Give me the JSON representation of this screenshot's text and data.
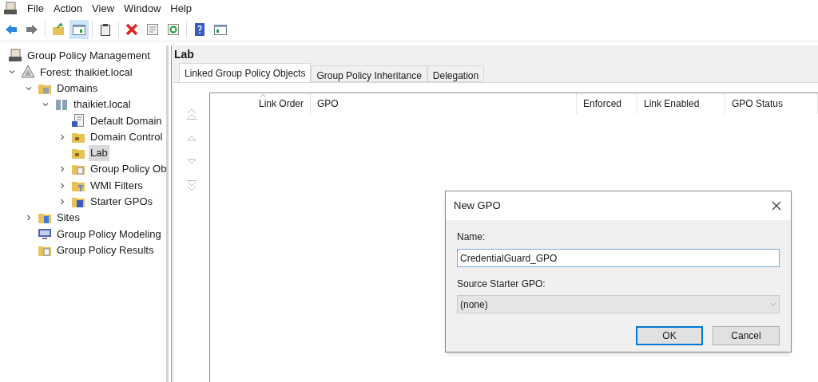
{
  "menu": [
    "File",
    "Action",
    "View",
    "Window",
    "Help"
  ],
  "toolbar": [
    {
      "kind": "back",
      "pressed": false
    },
    {
      "kind": "forward",
      "pressed": false
    },
    {
      "kind": "up",
      "pressed": false
    },
    {
      "kind": "pane",
      "pressed": true
    },
    {
      "kind": "clipboard",
      "pressed": false
    },
    {
      "kind": "delete",
      "pressed": false
    },
    {
      "kind": "properties",
      "pressed": false
    },
    {
      "kind": "refresh",
      "pressed": false
    },
    {
      "kind": "help",
      "pressed": false
    },
    {
      "kind": "pane2",
      "pressed": false
    }
  ],
  "tree": [
    {
      "label": "Group Policy Management",
      "kind": "console",
      "selected": false,
      "children": [
        {
          "label": "Forest: thaikiet.local",
          "kind": "forest",
          "expanded": true,
          "selected": false,
          "children": [
            {
              "label": "Domains",
              "kind": "domains",
              "expanded": true,
              "selected": false,
              "children": [
                {
                  "label": "thaikiet.local",
                  "kind": "domain",
                  "expanded": true,
                  "selected": false,
                  "children": [
                    {
                      "label": "Default Domain",
                      "kind": "gpo-link",
                      "selected": false
                    },
                    {
                      "label": "Domain Control",
                      "kind": "ou",
                      "expanded": false,
                      "selected": false
                    },
                    {
                      "label": "Lab",
                      "kind": "ou",
                      "selected": true
                    },
                    {
                      "label": "Group Policy Ob",
                      "kind": "gpo-folder",
                      "expanded": false,
                      "selected": false
                    },
                    {
                      "label": "WMI Filters",
                      "kind": "wmi",
                      "expanded": false,
                      "selected": false
                    },
                    {
                      "label": "Starter GPOs",
                      "kind": "starter",
                      "expanded": false,
                      "selected": false
                    }
                  ]
                }
              ]
            },
            {
              "label": "Sites",
              "kind": "sites",
              "expanded": false,
              "selected": false
            },
            {
              "label": "Group Policy Modeling",
              "kind": "modeling",
              "selected": false
            },
            {
              "label": "Group Policy Results",
              "kind": "results",
              "selected": false
            }
          ]
        }
      ]
    }
  ],
  "pane": {
    "title": "Lab",
    "tabs": [
      {
        "label": "Linked Group Policy Objects",
        "selected": true
      },
      {
        "label": "Group Policy Inheritance",
        "selected": false
      },
      {
        "label": "Delegation",
        "selected": false
      }
    ],
    "columns": [
      {
        "label": "Link Order",
        "sorted": true
      },
      {
        "label": "GPO",
        "sorted": false
      },
      {
        "label": "Enforced",
        "sorted": false
      },
      {
        "label": "Link Enabled",
        "sorted": false
      },
      {
        "label": "GPO Status",
        "sorted": false
      }
    ]
  },
  "dialog": {
    "title": "New GPO",
    "name_label": "Name:",
    "name_value": "CredentialGuard_GPO",
    "source_label": "Source Starter GPO:",
    "source_value": "(none)",
    "buttons": [
      {
        "label": "OK",
        "default": true
      },
      {
        "label": "Cancel",
        "default": false
      }
    ]
  }
}
